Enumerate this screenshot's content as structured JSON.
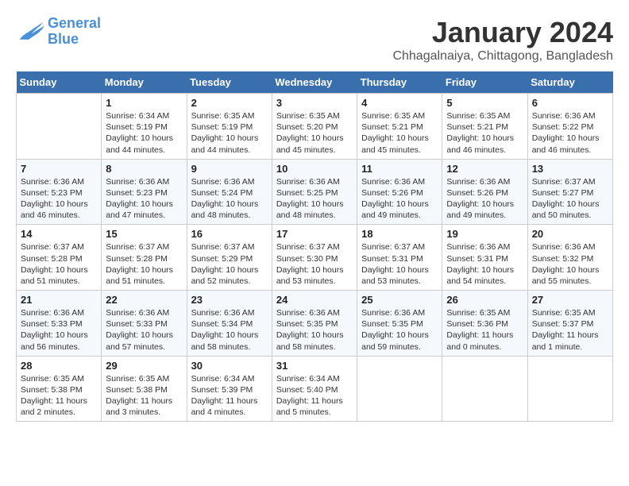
{
  "header": {
    "logo_line1": "General",
    "logo_line2": "Blue",
    "month": "January 2024",
    "location": "Chhagalnaiya, Chittagong, Bangladesh"
  },
  "days_of_week": [
    "Sunday",
    "Monday",
    "Tuesday",
    "Wednesday",
    "Thursday",
    "Friday",
    "Saturday"
  ],
  "weeks": [
    [
      {
        "day": "",
        "info": ""
      },
      {
        "day": "1",
        "info": "Sunrise: 6:34 AM\nSunset: 5:19 PM\nDaylight: 10 hours\nand 44 minutes."
      },
      {
        "day": "2",
        "info": "Sunrise: 6:35 AM\nSunset: 5:19 PM\nDaylight: 10 hours\nand 44 minutes."
      },
      {
        "day": "3",
        "info": "Sunrise: 6:35 AM\nSunset: 5:20 PM\nDaylight: 10 hours\nand 45 minutes."
      },
      {
        "day": "4",
        "info": "Sunrise: 6:35 AM\nSunset: 5:21 PM\nDaylight: 10 hours\nand 45 minutes."
      },
      {
        "day": "5",
        "info": "Sunrise: 6:35 AM\nSunset: 5:21 PM\nDaylight: 10 hours\nand 46 minutes."
      },
      {
        "day": "6",
        "info": "Sunrise: 6:36 AM\nSunset: 5:22 PM\nDaylight: 10 hours\nand 46 minutes."
      }
    ],
    [
      {
        "day": "7",
        "info": "Sunrise: 6:36 AM\nSunset: 5:23 PM\nDaylight: 10 hours\nand 46 minutes."
      },
      {
        "day": "8",
        "info": "Sunrise: 6:36 AM\nSunset: 5:23 PM\nDaylight: 10 hours\nand 47 minutes."
      },
      {
        "day": "9",
        "info": "Sunrise: 6:36 AM\nSunset: 5:24 PM\nDaylight: 10 hours\nand 48 minutes."
      },
      {
        "day": "10",
        "info": "Sunrise: 6:36 AM\nSunset: 5:25 PM\nDaylight: 10 hours\nand 48 minutes."
      },
      {
        "day": "11",
        "info": "Sunrise: 6:36 AM\nSunset: 5:26 PM\nDaylight: 10 hours\nand 49 minutes."
      },
      {
        "day": "12",
        "info": "Sunrise: 6:36 AM\nSunset: 5:26 PM\nDaylight: 10 hours\nand 49 minutes."
      },
      {
        "day": "13",
        "info": "Sunrise: 6:37 AM\nSunset: 5:27 PM\nDaylight: 10 hours\nand 50 minutes."
      }
    ],
    [
      {
        "day": "14",
        "info": "Sunrise: 6:37 AM\nSunset: 5:28 PM\nDaylight: 10 hours\nand 51 minutes."
      },
      {
        "day": "15",
        "info": "Sunrise: 6:37 AM\nSunset: 5:28 PM\nDaylight: 10 hours\nand 51 minutes."
      },
      {
        "day": "16",
        "info": "Sunrise: 6:37 AM\nSunset: 5:29 PM\nDaylight: 10 hours\nand 52 minutes."
      },
      {
        "day": "17",
        "info": "Sunrise: 6:37 AM\nSunset: 5:30 PM\nDaylight: 10 hours\nand 53 minutes."
      },
      {
        "day": "18",
        "info": "Sunrise: 6:37 AM\nSunset: 5:31 PM\nDaylight: 10 hours\nand 53 minutes."
      },
      {
        "day": "19",
        "info": "Sunrise: 6:36 AM\nSunset: 5:31 PM\nDaylight: 10 hours\nand 54 minutes."
      },
      {
        "day": "20",
        "info": "Sunrise: 6:36 AM\nSunset: 5:32 PM\nDaylight: 10 hours\nand 55 minutes."
      }
    ],
    [
      {
        "day": "21",
        "info": "Sunrise: 6:36 AM\nSunset: 5:33 PM\nDaylight: 10 hours\nand 56 minutes."
      },
      {
        "day": "22",
        "info": "Sunrise: 6:36 AM\nSunset: 5:33 PM\nDaylight: 10 hours\nand 57 minutes."
      },
      {
        "day": "23",
        "info": "Sunrise: 6:36 AM\nSunset: 5:34 PM\nDaylight: 10 hours\nand 58 minutes."
      },
      {
        "day": "24",
        "info": "Sunrise: 6:36 AM\nSunset: 5:35 PM\nDaylight: 10 hours\nand 58 minutes."
      },
      {
        "day": "25",
        "info": "Sunrise: 6:36 AM\nSunset: 5:35 PM\nDaylight: 10 hours\nand 59 minutes."
      },
      {
        "day": "26",
        "info": "Sunrise: 6:35 AM\nSunset: 5:36 PM\nDaylight: 11 hours\nand 0 minutes."
      },
      {
        "day": "27",
        "info": "Sunrise: 6:35 AM\nSunset: 5:37 PM\nDaylight: 11 hours\nand 1 minute."
      }
    ],
    [
      {
        "day": "28",
        "info": "Sunrise: 6:35 AM\nSunset: 5:38 PM\nDaylight: 11 hours\nand 2 minutes."
      },
      {
        "day": "29",
        "info": "Sunrise: 6:35 AM\nSunset: 5:38 PM\nDaylight: 11 hours\nand 3 minutes."
      },
      {
        "day": "30",
        "info": "Sunrise: 6:34 AM\nSunset: 5:39 PM\nDaylight: 11 hours\nand 4 minutes."
      },
      {
        "day": "31",
        "info": "Sunrise: 6:34 AM\nSunset: 5:40 PM\nDaylight: 11 hours\nand 5 minutes."
      },
      {
        "day": "",
        "info": ""
      },
      {
        "day": "",
        "info": ""
      },
      {
        "day": "",
        "info": ""
      }
    ]
  ]
}
